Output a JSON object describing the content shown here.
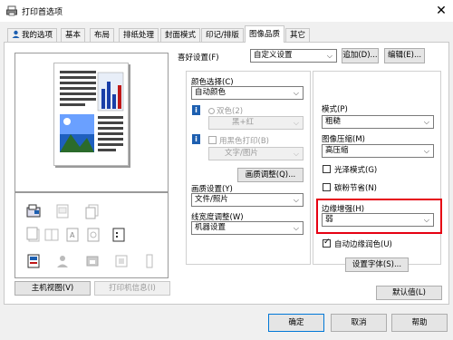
{
  "window": {
    "title": "打印首选项",
    "close_glyph": "✕"
  },
  "tabs": [
    {
      "label": "我的选项",
      "active": false
    },
    {
      "label": "基本",
      "active": false
    },
    {
      "label": "布局",
      "active": false
    },
    {
      "label": "排纸处理",
      "active": false
    },
    {
      "label": "封面模式",
      "active": false
    },
    {
      "label": "印记/排版",
      "active": false
    },
    {
      "label": "图像品质",
      "active": true
    },
    {
      "label": "其它",
      "active": false
    }
  ],
  "favorites": {
    "label": "喜好设置(F)",
    "value": "自定义设置",
    "add_button": "追加(D)...",
    "edit_button": "编辑(E)..."
  },
  "color_select": {
    "label": "颜色选择(C)",
    "value": "自动颜色",
    "dual_color_label": "双色(2)",
    "dual_color_value": "黑+红",
    "black_print_label": "用黑色打印(B)",
    "black_print_value": "文字/图片",
    "image_adjust_button": "画质调整(Q)..."
  },
  "image_settings": {
    "label": "画质设置(Y)",
    "value": "文件/照片"
  },
  "line_width": {
    "label": "线宽度调整(W)",
    "value": "机器设置"
  },
  "pattern": {
    "label": "模式(P)",
    "value": "粗糙"
  },
  "compression": {
    "label": "图像压缩(M)",
    "value": "高压缩"
  },
  "gloss_mode": {
    "label": "光泽模式(G)",
    "checked": false
  },
  "toner_save": {
    "label": "碳粉节省(N)",
    "checked": false
  },
  "edge_enhance": {
    "label": "边缘增强(H)",
    "value": "弱"
  },
  "auto_trapping": {
    "label": "自动边缘润色(U)",
    "checked": true
  },
  "font_settings_button": "设置字体(S)...",
  "left_buttons": {
    "printer_view": "主机视图(V)",
    "printer_info": "打印机信息(I)"
  },
  "defaults_button": "默认值(L)",
  "footer": {
    "ok": "确定",
    "cancel": "取消",
    "help": "帮助"
  },
  "colors": {
    "highlight": "#e60012",
    "info_icon": "#1d5fb0",
    "focus": "#0078d7"
  }
}
